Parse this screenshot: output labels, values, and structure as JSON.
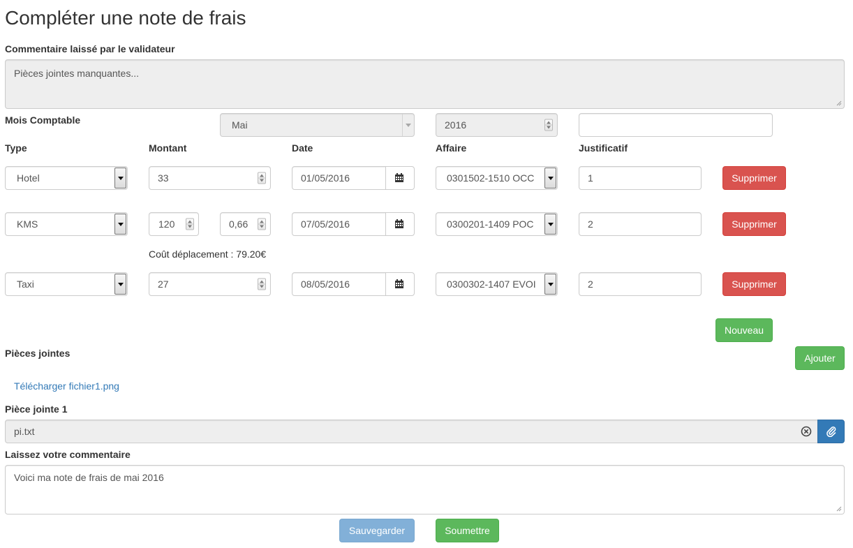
{
  "page": {
    "title": "Compléter une note de frais"
  },
  "validator_comment": {
    "label": "Commentaire laissé par le validateur",
    "value": "Pièces jointes manquantes..."
  },
  "accounting_month": {
    "label": "Mois Comptable",
    "month_value": "Mai",
    "year_value": "2016",
    "extra_value": ""
  },
  "headers": {
    "type": "Type",
    "amount": "Montant",
    "date": "Date",
    "project": "Affaire",
    "receipt": "Justificatif"
  },
  "expenses": [
    {
      "type": "Hotel",
      "amount": "33",
      "date": "01/05/2016",
      "project": "0301502-1510 OCC",
      "receipt": "1",
      "delete_label": "Supprimer"
    },
    {
      "type": "KMS",
      "km": "120",
      "rate": "0,66",
      "date": "07/05/2016",
      "project": "0300201-1409 POC",
      "receipt": "2",
      "delete_label": "Supprimer",
      "travel_cost": "Coût déplacement : 79.20€"
    },
    {
      "type": "Taxi",
      "amount": "27",
      "date": "08/05/2016",
      "project": "0300302-1407 EVOI",
      "receipt": "2",
      "delete_label": "Supprimer"
    }
  ],
  "actions": {
    "new_label": "Nouveau",
    "add_label": "Ajouter",
    "save_label": "Sauvegarder",
    "submit_label": "Soumettre"
  },
  "attachments": {
    "label": "Pièces jointes",
    "download_link": "Télécharger fichier1.png",
    "attachment1_label": "Pièce jointe 1",
    "attachment1_value": "pi.txt"
  },
  "user_comment": {
    "label": "Laissez votre commentaire",
    "value": "Voici ma note de frais de mai 2016"
  },
  "colors": {
    "danger": "#d9534f",
    "success": "#5cb85c",
    "primary": "#337ab7",
    "disabled_bg": "#eeeeee"
  },
  "icons": [
    "calendar-icon",
    "paperclip-icon",
    "clear-icon",
    "dropdown-arrow-icon",
    "spinner-icon",
    "resize-grip-icon"
  ]
}
